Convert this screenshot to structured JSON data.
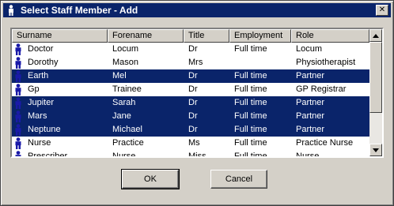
{
  "dialog": {
    "title": "Select Staff Member - Add",
    "close_label": "✕"
  },
  "table": {
    "columns": [
      "Surname",
      "Forename",
      "Title",
      "Employment",
      "Role"
    ],
    "rows": [
      {
        "surname": "Doctor",
        "forename": "Locum",
        "title": "Dr",
        "employment": "Full time",
        "role": "Locum",
        "selected": false
      },
      {
        "surname": "Dorothy",
        "forename": "Mason",
        "title": "Mrs",
        "employment": "",
        "role": "Physiotherapist",
        "selected": false
      },
      {
        "surname": "Earth",
        "forename": "Mel",
        "title": "Dr",
        "employment": "Full time",
        "role": "Partner",
        "selected": true
      },
      {
        "surname": "Gp",
        "forename": "Trainee",
        "title": "Dr",
        "employment": "Full time",
        "role": "GP Registrar",
        "selected": false
      },
      {
        "surname": "Jupiter",
        "forename": "Sarah",
        "title": "Dr",
        "employment": "Full time",
        "role": "Partner",
        "selected": true
      },
      {
        "surname": "Mars",
        "forename": "Jane",
        "title": "Dr",
        "employment": "Full time",
        "role": "Partner",
        "selected": true
      },
      {
        "surname": "Neptune",
        "forename": "Michael",
        "title": "Dr",
        "employment": "Full time",
        "role": "Partner",
        "selected": true
      },
      {
        "surname": "Nurse",
        "forename": "Practice",
        "title": "Ms",
        "employment": "Full time",
        "role": "Practice Nurse",
        "selected": false
      },
      {
        "surname": "Prescriber",
        "forename": "Nurse",
        "title": "Miss",
        "employment": "Full time",
        "role": "Nurse",
        "selected": false
      }
    ]
  },
  "buttons": {
    "ok": "OK",
    "cancel": "Cancel"
  },
  "colors": {
    "title_bar": "#0a246a",
    "selection": "#0a246a",
    "face": "#d4d0c8",
    "person_icon": "#1a1aa8"
  },
  "icons": {
    "title": "person-icon",
    "row": "person-icon",
    "scroll_up": "arrow-up-icon",
    "scroll_down": "arrow-down-icon"
  }
}
